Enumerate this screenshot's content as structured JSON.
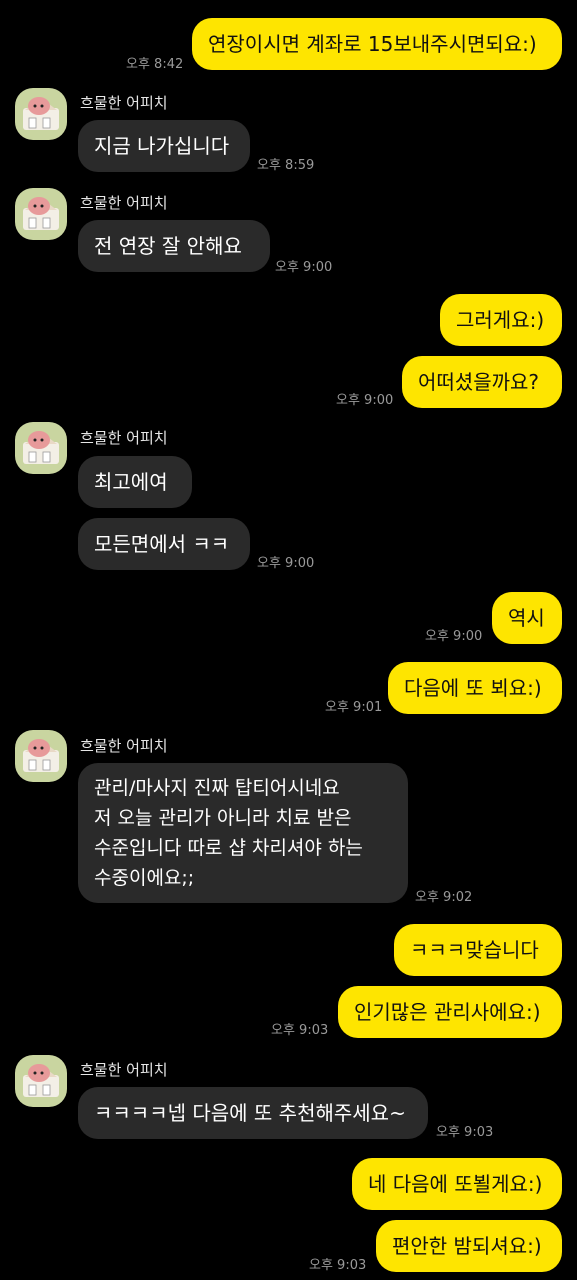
{
  "colors": {
    "background": "#000000",
    "my_bubble": "#FEE500",
    "peer_bubble": "#2A2A2A",
    "time_text": "#9A9A9A",
    "avatar_bg": "#C9D5A0"
  },
  "peer": {
    "name": "흐물한 어피치",
    "avatar_icon": "apeach-character-icon"
  },
  "messages": [
    {
      "id": "m1",
      "text": "연장이시면 계좌로 15보내주시면되요:)",
      "time": "오후 8:42"
    },
    {
      "id": "m2",
      "text": "지금 나가십니다",
      "time": "오후 8:59"
    },
    {
      "id": "m3",
      "text": "전 연장 잘 안해요",
      "time": "오후 9:00"
    },
    {
      "id": "m4",
      "text": "그러게요:)"
    },
    {
      "id": "m5",
      "text": "어떠셨을까요?",
      "time": "오후 9:00"
    },
    {
      "id": "m6",
      "text": "최고에여"
    },
    {
      "id": "m7",
      "text": "모든면에서 ㅋㅋ",
      "time": "오후 9:00"
    },
    {
      "id": "m8",
      "text": "역시",
      "time": "오후 9:00"
    },
    {
      "id": "m9",
      "text": "다음에 또 뵈요:)",
      "time": "오후 9:01"
    },
    {
      "id": "m10",
      "text": "관리/마사지 진짜 탑티어시네요\n저 오늘 관리가 아니라 치료 받은\n수준입니다 따로 샵 차리셔야 하는\n수중이에요;;",
      "time": "오후 9:02"
    },
    {
      "id": "m11",
      "text": "ㅋㅋㅋ맞습니다"
    },
    {
      "id": "m12",
      "text": "인기많은 관리사에요:)",
      "time": "오후 9:03"
    },
    {
      "id": "m13",
      "text": "ㅋㅋㅋㅋ넵 다음에 또 추천해주세요~",
      "time": "오후 9:03"
    },
    {
      "id": "m14",
      "text": "네 다음에 또뵐게요:)"
    },
    {
      "id": "m15",
      "text": "편안한 밤되셔요:)",
      "time": "오후 9:03"
    }
  ]
}
